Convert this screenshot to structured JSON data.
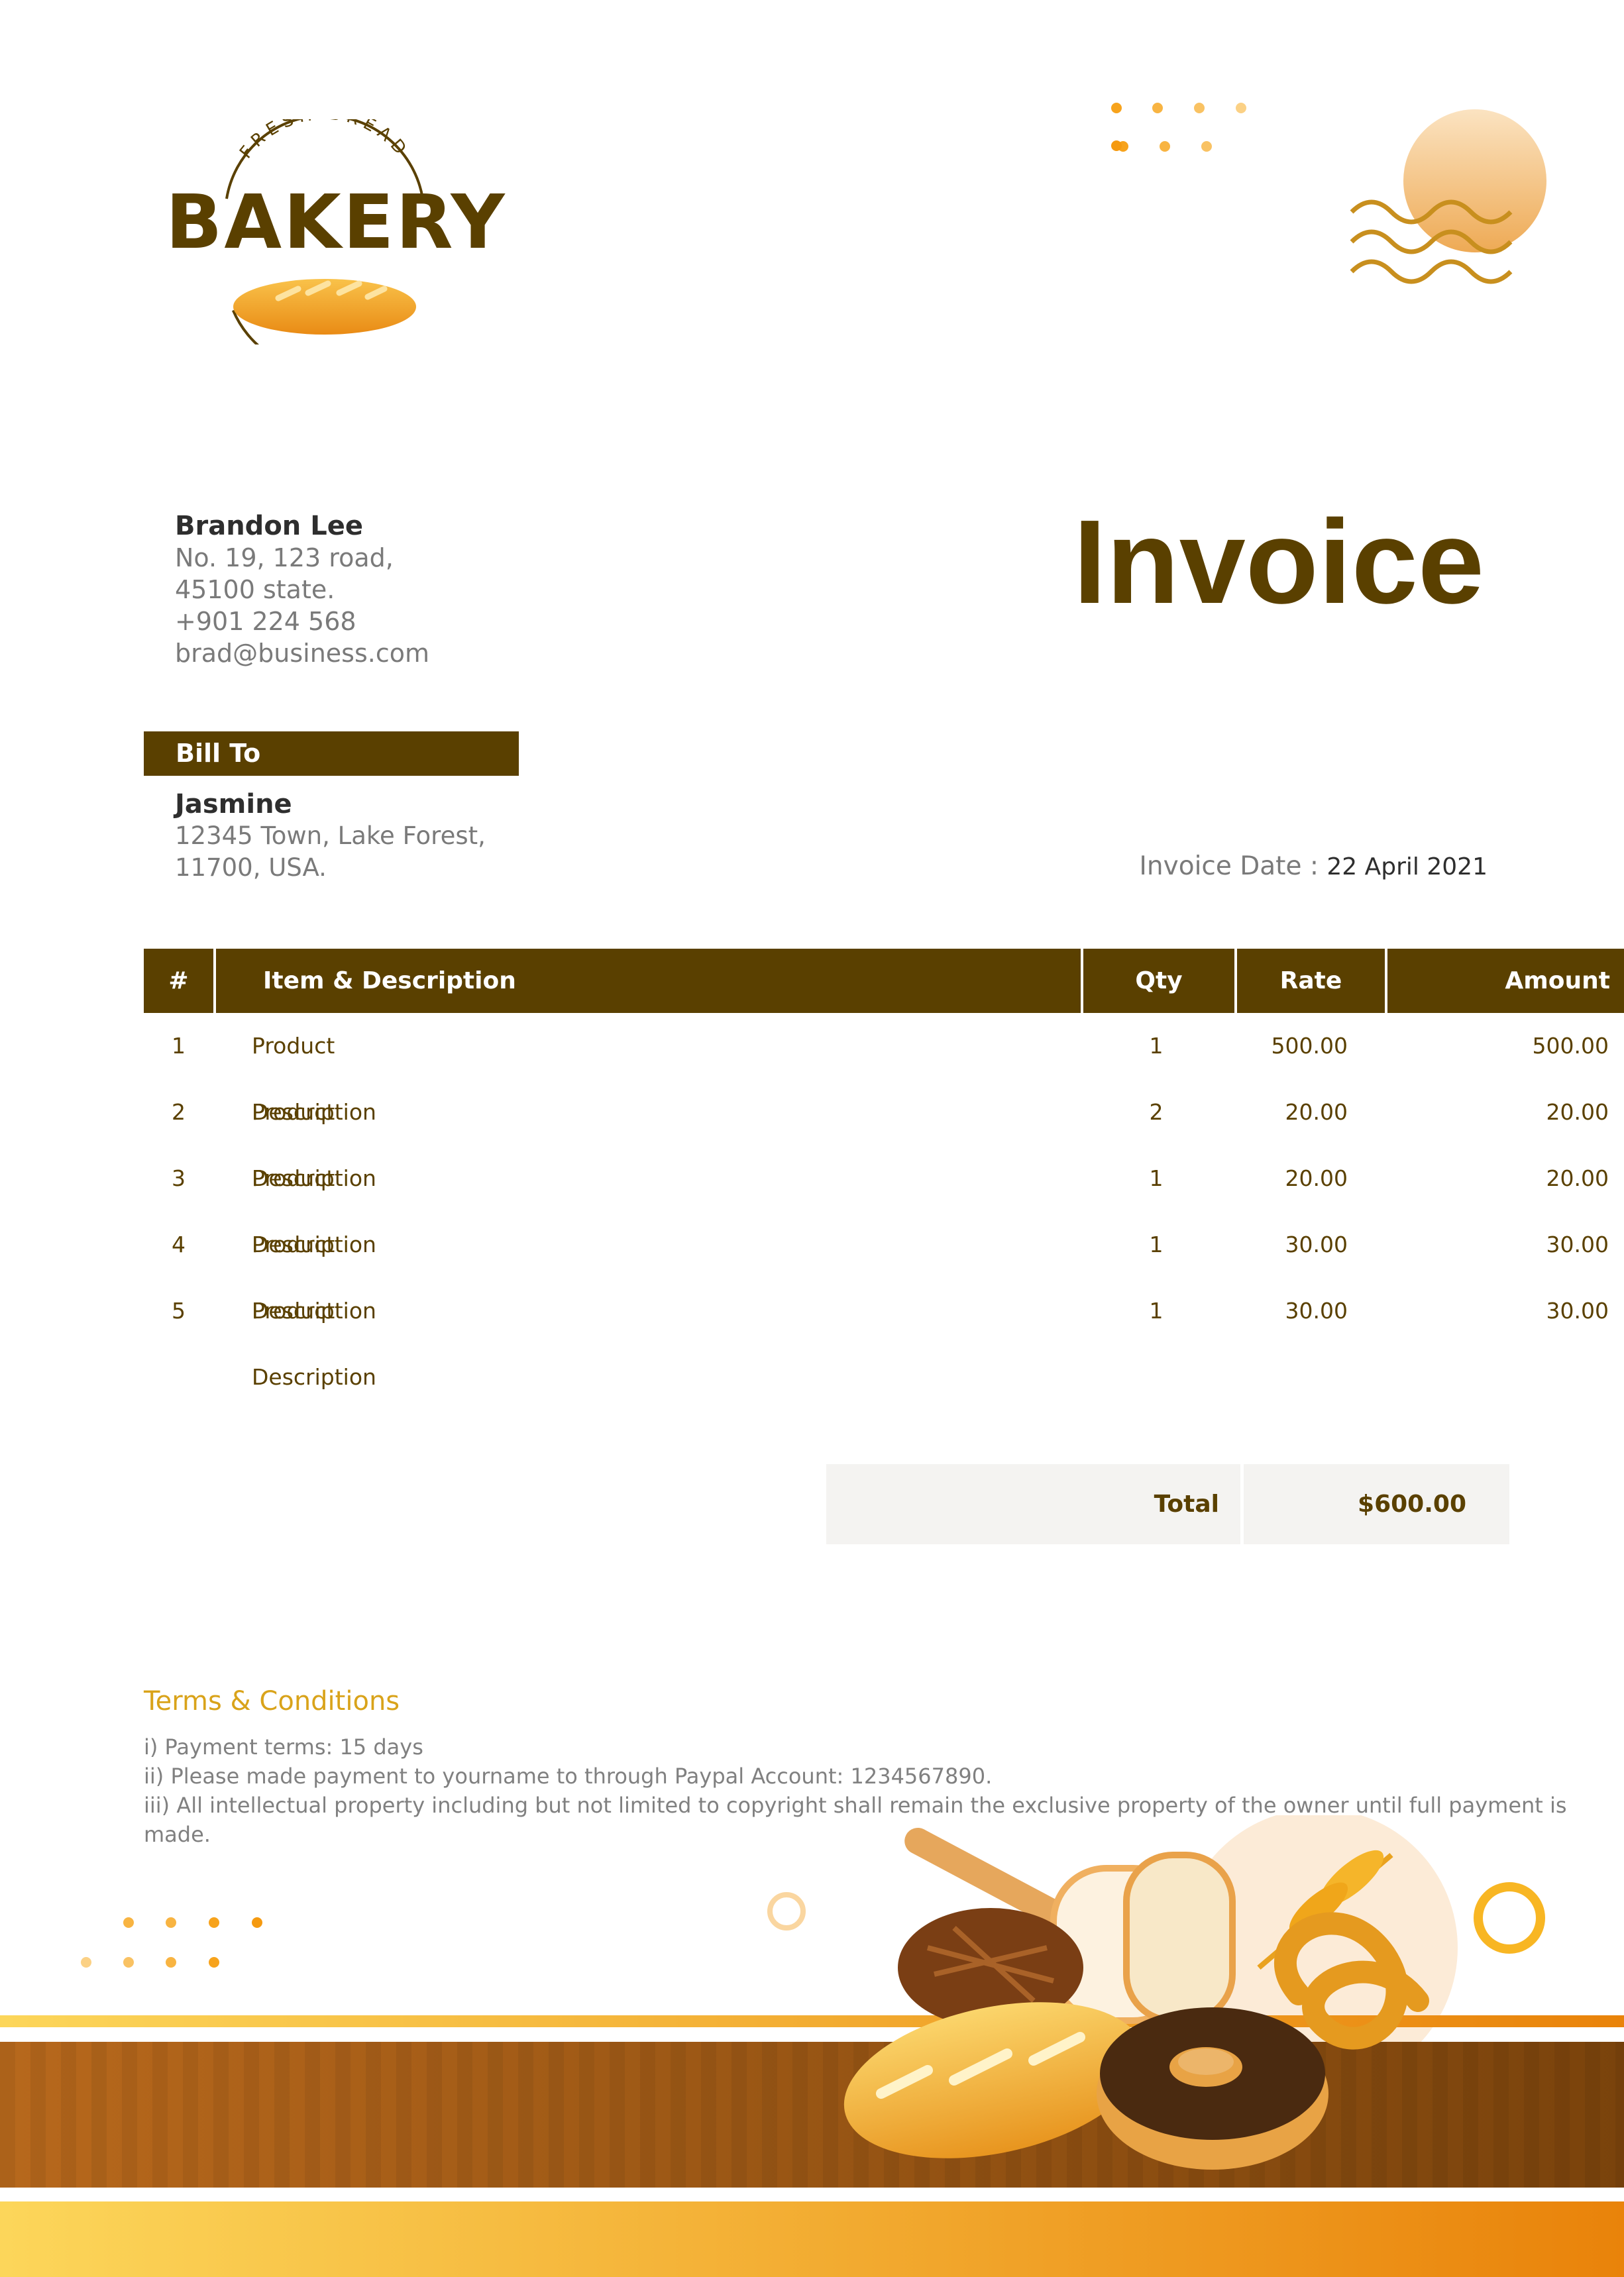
{
  "logo": {
    "arc_text": "FRESH BREAD",
    "brand": "BAKERY"
  },
  "sender": {
    "name": "Brandon Lee",
    "address_line1": "No. 19, 123 road,",
    "address_line2": "45100 state.",
    "phone": "+901 224 568",
    "email": "brad@business.com"
  },
  "document_title": "Invoice",
  "bill_to": {
    "label": "Bill To",
    "name": "Jasmine",
    "address_line1": "12345 Town, Lake Forest,",
    "address_line2": "11700, USA."
  },
  "invoice_date": {
    "label": "Invoice Date : ",
    "value": "22 April 2021"
  },
  "table": {
    "headers": {
      "num": "#",
      "item": "Item & Description",
      "qty": "Qty",
      "rate": "Rate",
      "amount": "Amount"
    },
    "rows": [
      {
        "num": "1",
        "item": "Product Description",
        "qty": "1",
        "rate": "500.00",
        "amount": "500.00"
      },
      {
        "num": "2",
        "item": "Product Description",
        "qty": "2",
        "rate": "20.00",
        "amount": "20.00"
      },
      {
        "num": "3",
        "item": "Product Description",
        "qty": "1",
        "rate": "20.00",
        "amount": "20.00"
      },
      {
        "num": "4",
        "item": "Product Description",
        "qty": "1",
        "rate": "30.00",
        "amount": "30.00"
      },
      {
        "num": "5",
        "item": "Product Description",
        "qty": "1",
        "rate": "30.00",
        "amount": "30.00"
      }
    ]
  },
  "total": {
    "label": "Total",
    "value": "$600.00"
  },
  "terms": {
    "title": "Terms & Conditions",
    "lines": [
      "i) Payment terms: 15 days",
      "ii) Please made payment to yourname to through Paypal Account: 1234567890.",
      "iii) All intellectual property including but not limited to copyright shall remain the exclusive property of the owner until full payment is made."
    ]
  },
  "colors": {
    "brand_brown": "#5a4000",
    "accent_gold": "#d9a31a",
    "orange": "#f2a01c",
    "muted_text": "#7a7a7a"
  }
}
